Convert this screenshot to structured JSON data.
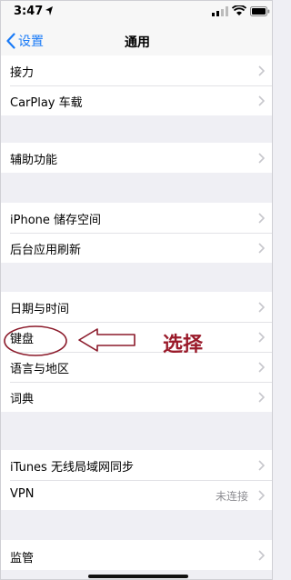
{
  "status_bar": {
    "time": "3:47",
    "icons": [
      "location-icon",
      "signal-icon",
      "wifi-icon",
      "battery-icon"
    ]
  },
  "nav": {
    "back_label": "设置",
    "title": "通用"
  },
  "groups": [
    {
      "rows": [
        {
          "label": "接力"
        },
        {
          "label": "CarPlay 车载"
        }
      ]
    },
    {
      "rows": [
        {
          "label": "辅助功能"
        }
      ]
    },
    {
      "rows": [
        {
          "label": "iPhone 储存空间"
        },
        {
          "label": "后台应用刷新"
        }
      ]
    },
    {
      "rows": [
        {
          "label": "日期与时间"
        },
        {
          "label": "键盘"
        },
        {
          "label": "语言与地区"
        },
        {
          "label": "词典"
        }
      ]
    },
    {
      "rows": [
        {
          "label": "iTunes 无线局域网同步"
        },
        {
          "label": "VPN",
          "value": "未连接"
        }
      ]
    },
    {
      "rows": [
        {
          "label": "监管"
        }
      ]
    }
  ],
  "annotation": {
    "text": "选择",
    "color": "#9a1a2a"
  },
  "colors": {
    "accent": "#1a7bf7",
    "background": "#efeff4",
    "secondary_text": "#8e8e93"
  }
}
